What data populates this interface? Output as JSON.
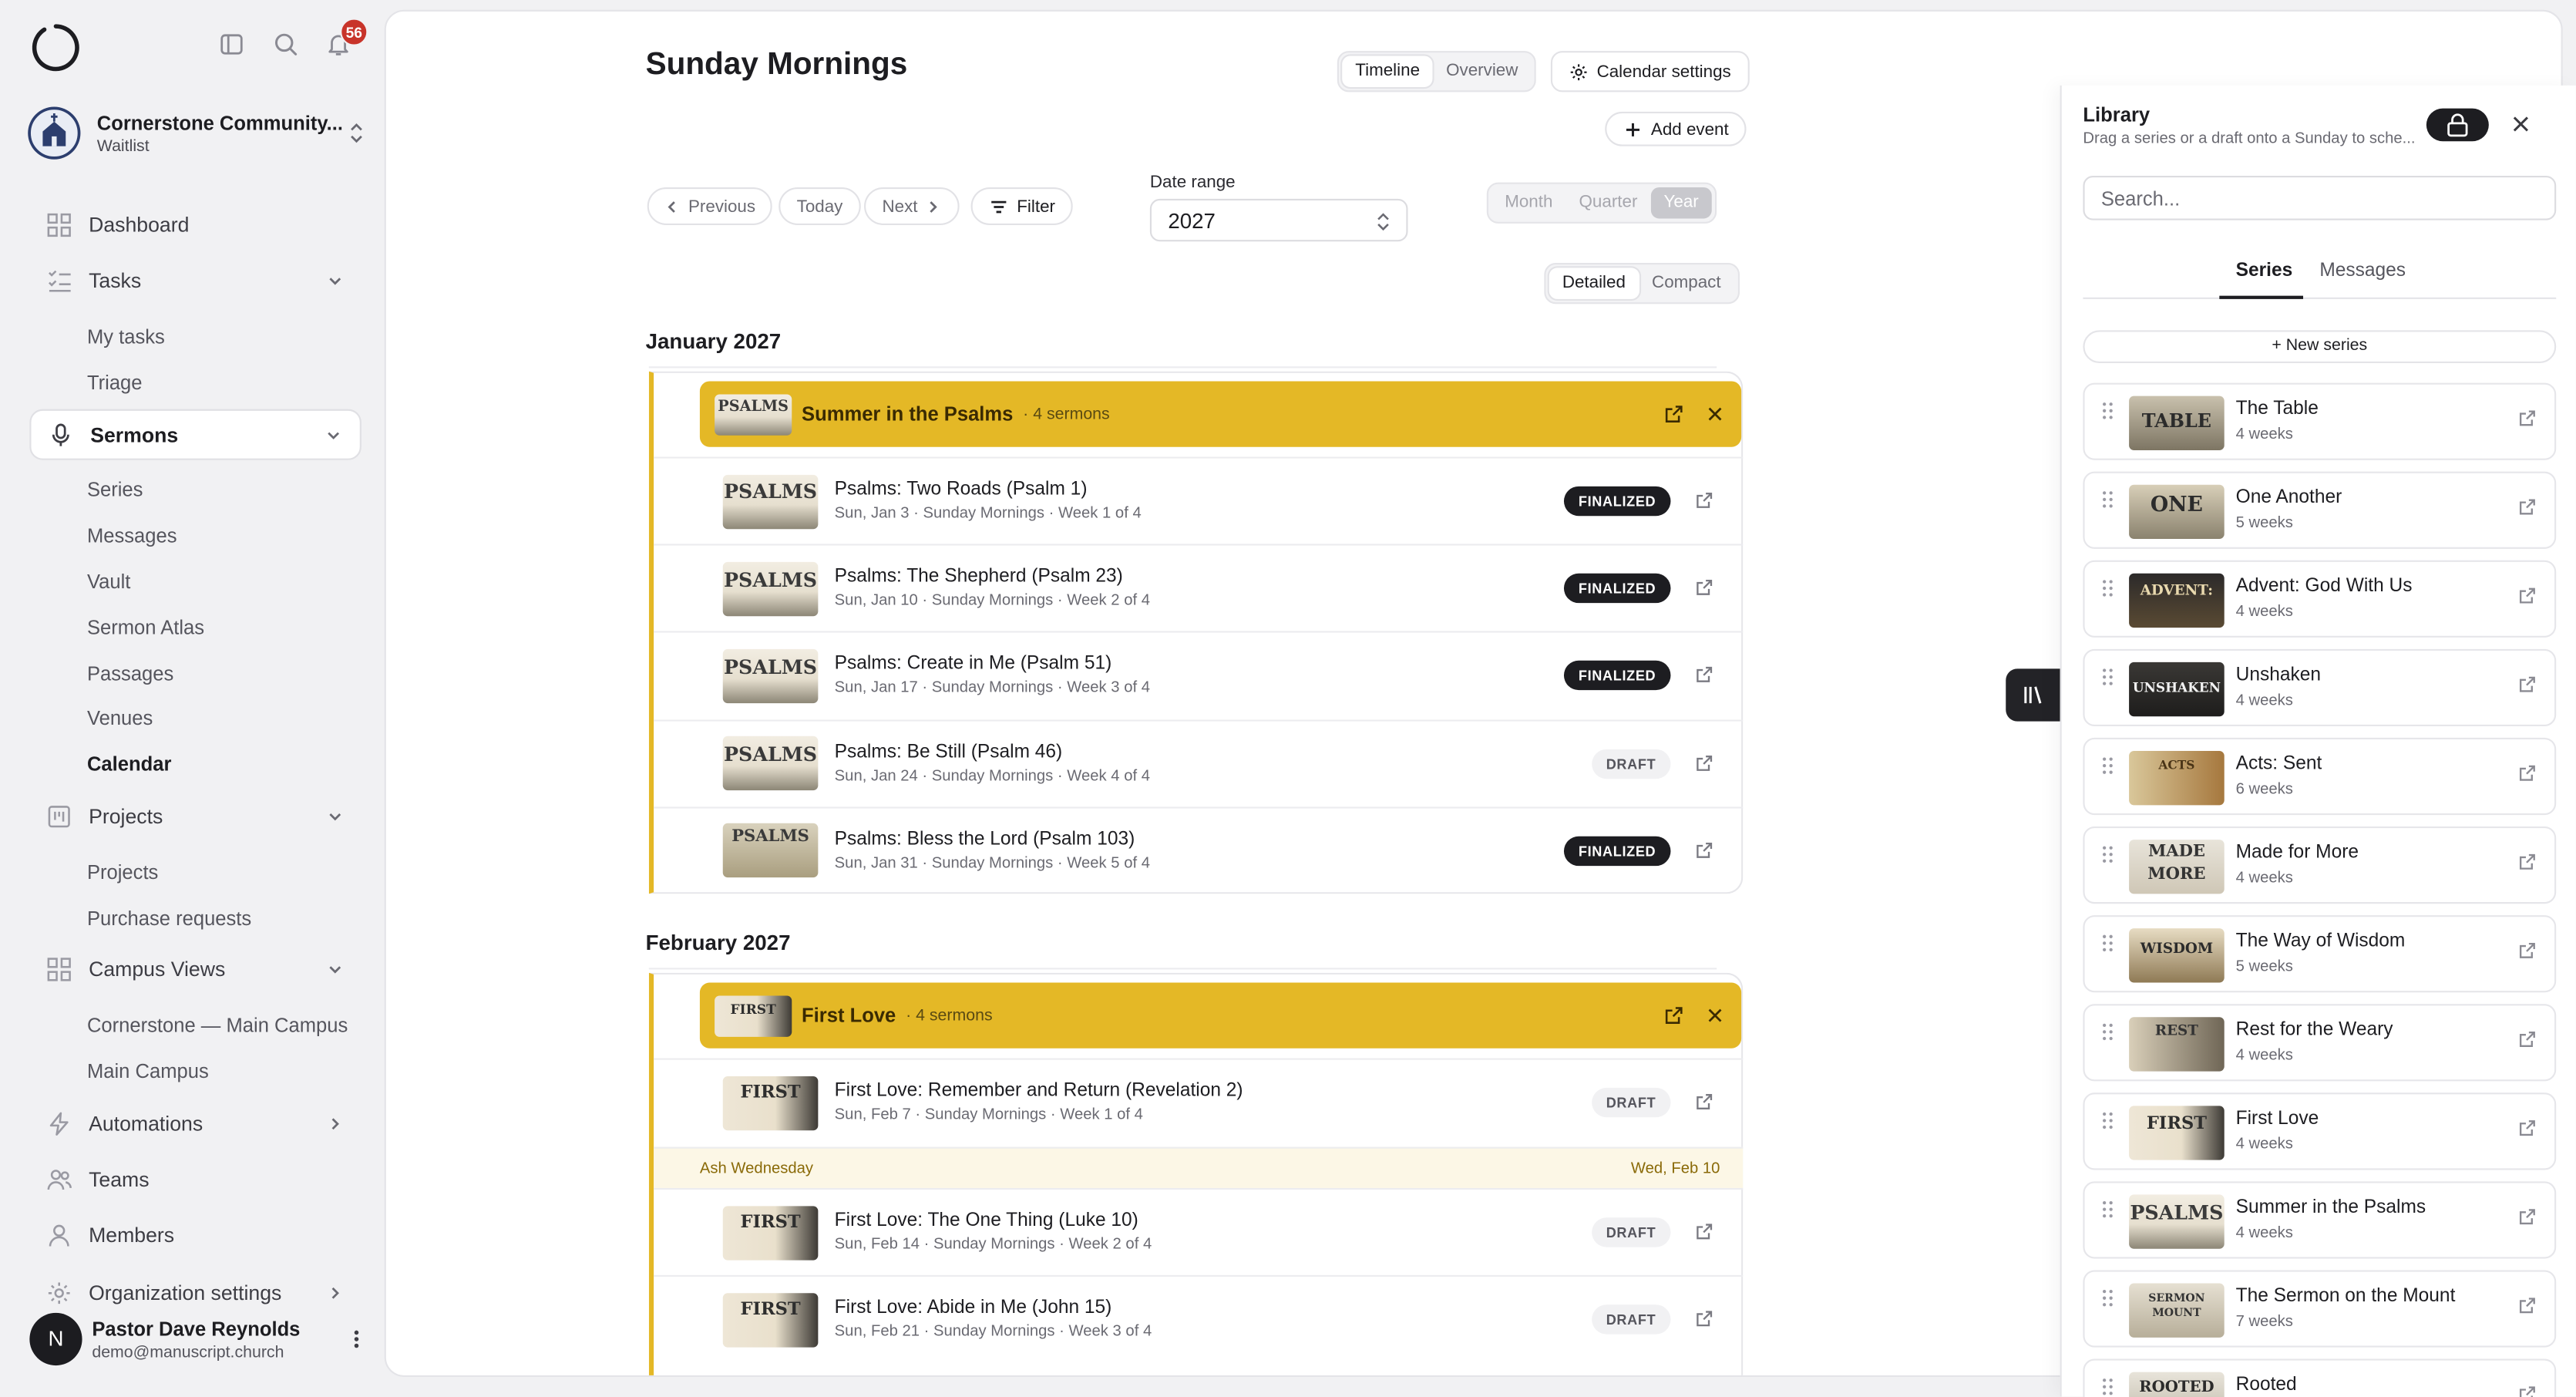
{
  "sidebar": {
    "notifications_count": "56",
    "org": {
      "name": "Cornerstone Community...",
      "status": "Waitlist"
    },
    "nav": {
      "dashboard": "Dashboard",
      "tasks": "Tasks",
      "my_tasks": "My tasks",
      "triage": "Triage",
      "sermons": "Sermons",
      "series": "Series",
      "messages": "Messages",
      "vault": "Vault",
      "sermon_atlas": "Sermon Atlas",
      "passages": "Passages",
      "venues": "Venues",
      "calendar": "Calendar",
      "projects": "Projects",
      "projects_sub": "Projects",
      "purchase_requests": "Purchase requests",
      "campus_views": "Campus Views",
      "main_campus_full": "Cornerstone — Main Campus",
      "main_campus": "Main Campus",
      "automations": "Automations",
      "teams": "Teams",
      "members": "Members",
      "org_settings": "Organization settings"
    },
    "user": {
      "initial": "N",
      "name": "Pastor Dave Reynolds",
      "email": "demo@manuscript.church"
    }
  },
  "main": {
    "title": "Sunday Mornings",
    "view_tabs": [
      "Timeline",
      "Overview"
    ],
    "calendar_settings": "Calendar settings",
    "add_event": "Add event",
    "nav": {
      "previous": "Previous",
      "today": "Today",
      "next": "Next",
      "filter": "Filter"
    },
    "date_range_label": "Date range",
    "date_range_value": "2027",
    "period_tabs": [
      "Month",
      "Quarter",
      "Year"
    ],
    "density_tabs": [
      "Detailed",
      "Compact"
    ],
    "months": [
      {
        "name": "January 2027",
        "series": {
          "title": "Summer in the Psalms",
          "count": "· 4 sermons"
        },
        "rows": [
          {
            "title": "Psalms: Two Roads (Psalm 1)",
            "sub": "Sun, Jan 3 · Sunday Mornings · Week 1 of 4",
            "status": "FINALIZED"
          },
          {
            "title": "Psalms: The Shepherd (Psalm 23)",
            "sub": "Sun, Jan 10 · Sunday Mornings · Week 2 of 4",
            "status": "FINALIZED"
          },
          {
            "title": "Psalms: Create in Me (Psalm 51)",
            "sub": "Sun, Jan 17 · Sunday Mornings · Week 3 of 4",
            "status": "FINALIZED"
          },
          {
            "title": "Psalms: Be Still (Psalm 46)",
            "sub": "Sun, Jan 24 · Sunday Mornings · Week 4 of 4",
            "status": "DRAFT"
          },
          {
            "title": "Psalms: Bless the Lord (Psalm 103)",
            "sub": "Sun, Jan 31 · Sunday Mornings · Week 5 of 4",
            "status": "FINALIZED"
          }
        ]
      },
      {
        "name": "February 2027",
        "series": {
          "title": "First Love",
          "count": "· 4 sermons"
        },
        "rows": [
          {
            "title": "First Love: Remember and Return (Revelation 2)",
            "sub": "Sun, Feb 7 · Sunday Mornings · Week 1 of 4",
            "status": "DRAFT"
          },
          {
            "title": "First Love: The One Thing (Luke 10)",
            "sub": "Sun, Feb 14 · Sunday Mornings · Week 2 of 4",
            "status": "DRAFT"
          },
          {
            "title": "First Love: Abide in Me (John 15)",
            "sub": "Sun, Feb 21 · Sunday Mornings · Week 3 of 4",
            "status": "DRAFT"
          }
        ],
        "observance": {
          "name": "Ash Wednesday",
          "date": "Wed, Feb 10"
        }
      }
    ]
  },
  "library": {
    "title": "Library",
    "subtitle": "Drag a series or a draft onto a Sunday to sche...",
    "search_placeholder": "Search...",
    "tabs": [
      "Series",
      "Messages"
    ],
    "new_series": "+ New series",
    "items": [
      {
        "name": "The Table",
        "weeks": "4 weeks"
      },
      {
        "name": "One Another",
        "weeks": "5 weeks"
      },
      {
        "name": "Advent: God With Us",
        "weeks": "4 weeks"
      },
      {
        "name": "Unshaken",
        "weeks": "4 weeks"
      },
      {
        "name": "Acts: Sent",
        "weeks": "6 weeks"
      },
      {
        "name": "Made for More",
        "weeks": "4 weeks"
      },
      {
        "name": "The Way of Wisdom",
        "weeks": "5 weeks"
      },
      {
        "name": "Rest for the Weary",
        "weeks": "4 weeks"
      },
      {
        "name": "First Love",
        "weeks": "4 weeks"
      },
      {
        "name": "Summer in the Psalms",
        "weeks": "4 weeks"
      },
      {
        "name": "The Sermon on the Mount",
        "weeks": "7 weeks"
      },
      {
        "name": "Rooted",
        "weeks": ""
      }
    ]
  },
  "thumb_art": {
    "psalms": "PSALMS",
    "first": "FIRST",
    "table": "TABLE",
    "one": "ONE",
    "advent": "ADVENT:",
    "unshaken": "UNSHAKEN",
    "acts": "ACTS",
    "made": "MADE",
    "more": "MORE",
    "wisdom": "WISDOM",
    "rest": "REST",
    "sermon": "SERMON",
    "mount": "MOUNT",
    "rooted": "ROOTED"
  },
  "colors": {
    "accent_series": "#e4b826",
    "badge_finalized": "#1d1d21",
    "notification": "#c8342a"
  }
}
